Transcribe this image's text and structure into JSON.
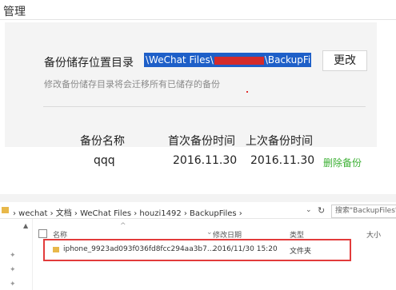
{
  "top": {
    "title": "管理",
    "backup_dir_label": "备份储存位置目录",
    "path_part1": "\\WeChat Files\\",
    "path_part2": "\\BackupFiles\\",
    "change_button": "更改",
    "hint": "修改备份储存目录将会迁移所有已储存的备份",
    "columns": {
      "name": "备份名称",
      "first": "首次备份时间",
      "last": "上次备份时间"
    },
    "row": {
      "name": "qqq",
      "first": "2016.11.30",
      "last": "2016.11.30",
      "delete": "删除备份"
    }
  },
  "explorer": {
    "breadcrumb": "› wechat › 文档 › WeChat Files › houzi1492 › BackupFiles ›",
    "dropdown_icon": "chevron-down-icon",
    "refresh_icon": "refresh-icon",
    "search_placeholder": "搜索\"BackupFiles\"",
    "headers": {
      "name": "名称",
      "date": "修改日期",
      "type": "类型",
      "size": "大小"
    },
    "rows": [
      {
        "name": "iphone_9923ad093f036fd8fcc294aa3b7...",
        "date": "2016/11/30 15:20",
        "type": "文件夹",
        "size": ""
      }
    ],
    "highlight_color": "#e23b3b"
  },
  "colors": {
    "delete_link": "#3cb034",
    "path_selection": "#1e5fc8",
    "redaction": "#d42b2b"
  }
}
